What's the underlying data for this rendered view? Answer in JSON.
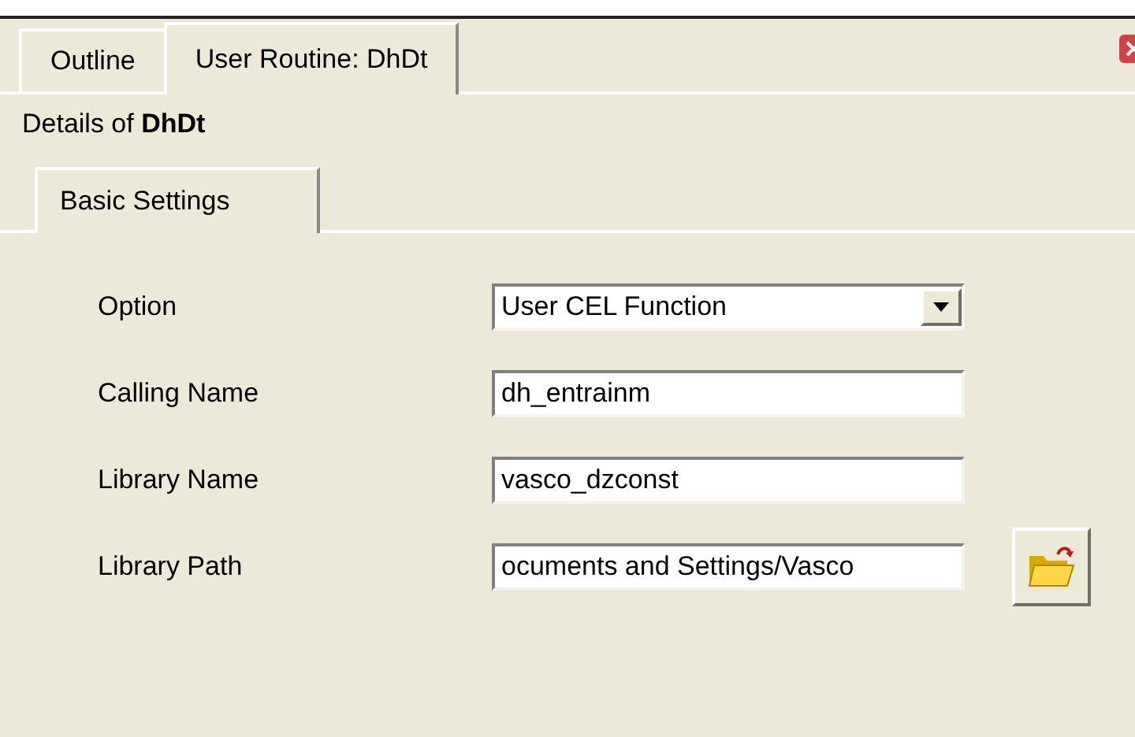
{
  "tabs": [
    {
      "label": "Outline",
      "selected": false
    },
    {
      "label": "User Routine: DhDt",
      "selected": true
    }
  ],
  "details": {
    "prefix": "Details of",
    "name": "DhDt"
  },
  "sub_tabs": [
    {
      "label": "Basic Settings",
      "selected": true
    }
  ],
  "fields": [
    {
      "kind": "select",
      "label": "Option",
      "value": "User CEL Function"
    },
    {
      "kind": "text",
      "label": "Calling Name",
      "value": "dh_entrainm"
    },
    {
      "kind": "text",
      "label": "Library Name",
      "value": "vasco_dzconst"
    },
    {
      "kind": "path",
      "label": "Library Path",
      "value": "ocuments and Settings/Vasco"
    }
  ]
}
